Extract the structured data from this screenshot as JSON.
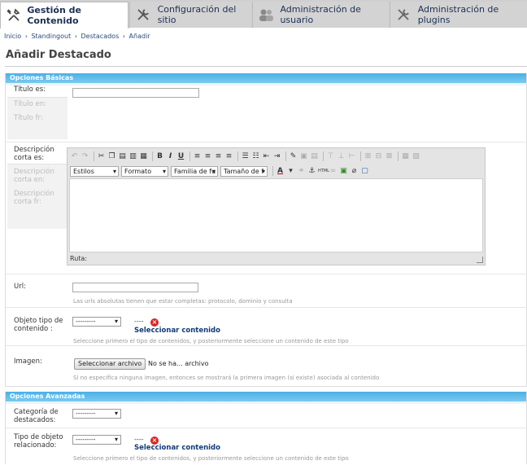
{
  "tabs": [
    {
      "label": "Gestión de Contenido",
      "icon": "tools-icon"
    },
    {
      "label": "Configuración del sitio",
      "icon": "wrench-screwdriver-icon"
    },
    {
      "label": "Administración de usuario",
      "icon": "users-icon"
    },
    {
      "label": "Administración de plugins",
      "icon": "plugin-tools-icon"
    }
  ],
  "breadcrumb": [
    "Inicio",
    "›",
    "Standingout",
    "›",
    "Destacados",
    "›",
    "Añadir"
  ],
  "page_title": "Añadir Destacado",
  "basic": {
    "legend": "Opciones Básicas",
    "title_labels": [
      "Título es:",
      "Título en:",
      "Título fr:"
    ],
    "desc_labels": [
      "Descripción corta es:",
      "Descripción corta en:",
      "Descripción corta fr:"
    ],
    "editor": {
      "selects": [
        "Estilos",
        "Formato",
        "Familia de fu",
        "Tamaño de f"
      ],
      "path_label": "Ruta:"
    },
    "url_label": "Url:",
    "url_help": "Las urls absolutas tienen que estar completas: protocolo, dominio y consulta",
    "object_type_label": "Objeto tipo de contenido :",
    "object_type_select": "---------",
    "object_value": "----",
    "select_content_link": "Seleccionar contenido",
    "object_help": "Seleccione primero el tipo de contenidos, y posteriormente seleccione un contenido de este tipo",
    "image_label": "Imagen:",
    "file_button": "Seleccionar archivo",
    "file_status": "No se ha... archivo",
    "image_help": "Si no especifica ninguna imagen, entonces se mostrará la primera imagen (si existe) asociada al contenido"
  },
  "advanced": {
    "legend": "Opciones Avanzadas",
    "category_label": "Categoría de destacados:",
    "category_select": "---------",
    "related_label": "Tipo de objeto relacionado:",
    "related_select": "---------",
    "related_value": "----",
    "select_content_link": "Seleccionar contenido",
    "related_help": "Seleccione primero el tipo de contenidos, y posteriormente seleccione un contenido de este tipo"
  }
}
